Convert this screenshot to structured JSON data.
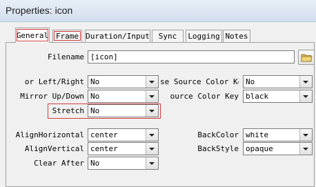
{
  "window": {
    "title": "Properties: icon"
  },
  "tabs": [
    {
      "label": "General"
    },
    {
      "label": "Frame"
    },
    {
      "label": "Duration/Input"
    },
    {
      "label": "Sync"
    },
    {
      "label": "Logging"
    },
    {
      "label": "Notes"
    }
  ],
  "general": {
    "filename": {
      "label": "Filename",
      "value": "[icon]"
    },
    "mirror_lr": {
      "label": "or Left/Right",
      "value": "No"
    },
    "mirror_ud": {
      "label": "Mirror Up/Down",
      "value": "No"
    },
    "stretch": {
      "label": "Stretch",
      "value": "No"
    },
    "align_h": {
      "label": "AlignHorizontal",
      "value": "center"
    },
    "align_v": {
      "label": "AlignVertical",
      "value": "center"
    },
    "clear_after": {
      "label": "Clear After",
      "value": "No"
    },
    "use_source_color_key": {
      "label": "se Source Color Key",
      "value": "No"
    },
    "source_color_key": {
      "label": "ource Color Key",
      "value": "black"
    },
    "back_color": {
      "label": "BackColor",
      "value": "white"
    },
    "back_style": {
      "label": "BackStyle",
      "value": "opaque"
    }
  },
  "icons": {
    "browse": "folder-icon",
    "dropdown": "chevron-down-icon"
  },
  "colors": {
    "highlight": "#d23b3b",
    "titlebar": "#dbe5f1"
  }
}
